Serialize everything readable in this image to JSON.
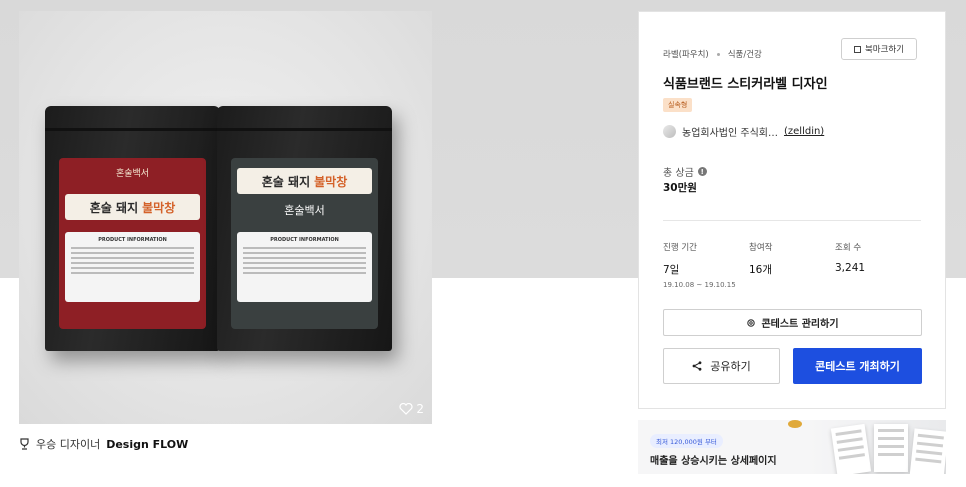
{
  "product": {
    "pouch_brand_mark": "혼술백서",
    "pouch_banner_main": "혼술 돼지",
    "pouch_banner_highlight": "불막창",
    "pouch_info_title": "PRODUCT INFORMATION",
    "like_count": "2"
  },
  "award": {
    "prefix": "우승 디자이너",
    "designer": "Design FLOW"
  },
  "card": {
    "category": "라벨(파우치)",
    "subcategory": "식품/건강",
    "bookmark_label": "북마크하기",
    "title": "식품브랜드 스티커라벨 디자인",
    "tag": "실속형",
    "company_name": "농업회사법인 주식회…",
    "company_id": "(zelldin)",
    "prize_label": "총 상금",
    "prize_value": "30만원",
    "period_label": "진행 기간",
    "period_value": "7일",
    "period_dates": "19.10.08 ~ 19.10.15",
    "entries_label": "참여작",
    "entries_value": "16개",
    "views_label": "조회 수",
    "views_value": "3,241",
    "manage_label": "콘테스트 관리하기",
    "share_label": "공유하기",
    "open_label": "콘테스트 개최하기"
  },
  "ad": {
    "pill": "최저 120,000원 부터",
    "headline": "매출을 상승시키는 상세페이지"
  },
  "colors": {
    "primary": "#1d4fe0",
    "tag_bg": "#fbe0c8",
    "tag_text": "#b65a1a",
    "red_label": "#8e1f25",
    "grey_label": "#3a4040"
  }
}
